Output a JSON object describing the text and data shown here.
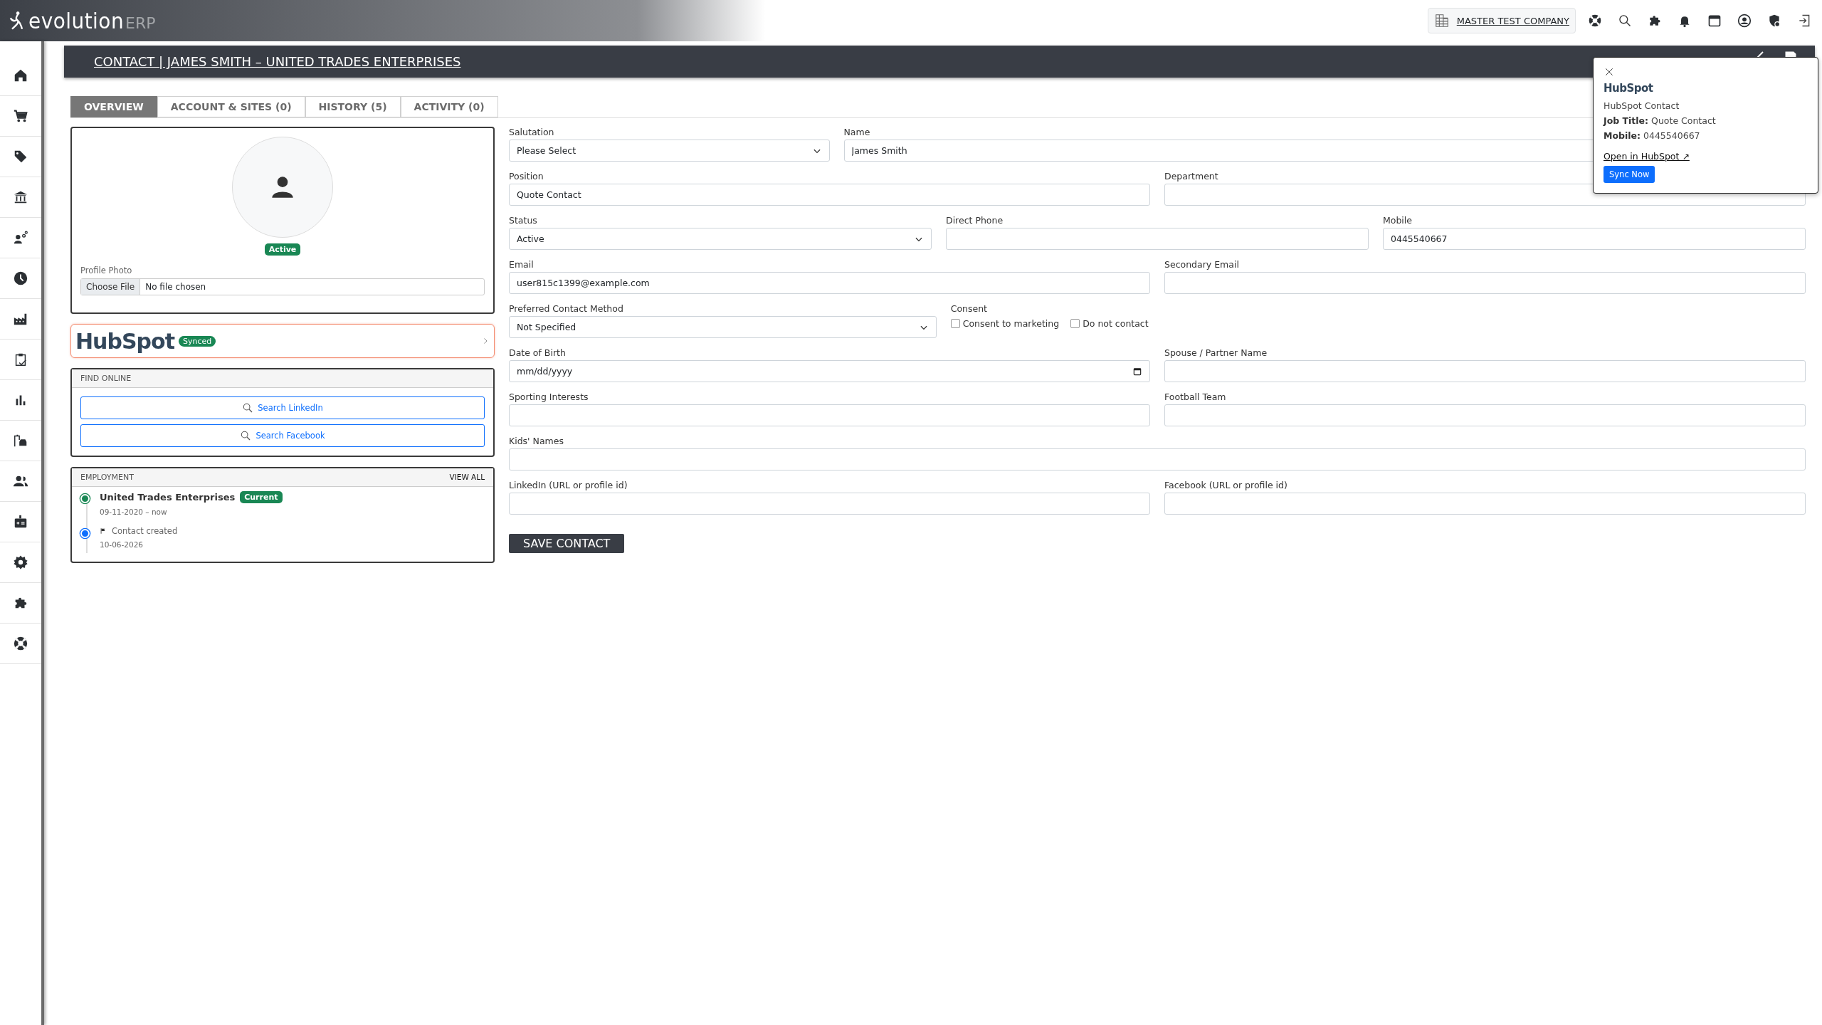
{
  "topbar": {
    "logo": {
      "word": "evolution",
      "suffix": "ERP"
    },
    "company": "MASTER TEST COMPANY"
  },
  "title": "CONTACT | JAMES SMITH – UNITED TRADES ENTERPRISES",
  "tabs": [
    {
      "label": "OVERVIEW",
      "selected": true
    },
    {
      "label": "ACCOUNT & SITES (0)",
      "selected": false
    },
    {
      "label": "HISTORY (5)",
      "selected": false
    },
    {
      "label": "ACTIVITY (0)",
      "selected": false
    }
  ],
  "profile": {
    "status": "Active",
    "photo_label": "Profile Photo",
    "file_button": "Choose File",
    "file_status": "No file chosen"
  },
  "hubspot_card": {
    "logo": "HubSpot",
    "badge": "Synced"
  },
  "find_online": {
    "heading": "FIND ONLINE",
    "buttons": [
      "Search LinkedIn",
      "Search Facebook"
    ]
  },
  "employment": {
    "heading": "EMPLOYMENT",
    "view_all": "VIEW ALL",
    "items": [
      {
        "kind": "job",
        "title": "United Trades Enterprises",
        "badge": "Current",
        "dates": "09-11-2020 – now",
        "color": "#198754"
      },
      {
        "kind": "event",
        "text": "Contact created",
        "date": "10-06-2026",
        "color": "#0d6efd"
      }
    ]
  },
  "form": {
    "rows": [
      [
        {
          "kind": "select",
          "label": "Salutation",
          "value": "Please Select"
        },
        {
          "kind": "text",
          "label": "Name",
          "value": "James Smith"
        }
      ],
      [
        {
          "kind": "text",
          "label": "Position",
          "value": "Quote Contact"
        },
        {
          "kind": "text",
          "label": "Department"
        }
      ],
      [
        {
          "kind": "select",
          "label": "Status",
          "value": "Active"
        },
        {
          "kind": "text",
          "label": "Direct Phone"
        },
        {
          "kind": "text",
          "label": "Mobile",
          "value": "0445540667"
        }
      ],
      [
        {
          "kind": "text",
          "label": "Email",
          "value": "user815c1399@example.com"
        },
        {
          "kind": "text",
          "label": "Secondary Email"
        }
      ],
      [
        {
          "kind": "select",
          "label": "Preferred Contact Method",
          "value": "Not Specified"
        },
        {
          "kind": "checks",
          "label": "Consent",
          "options": [
            {
              "label": "Consent to marketing",
              "checked": false
            },
            {
              "label": "Do not contact",
              "checked": false
            }
          ]
        }
      ],
      [
        {
          "kind": "date",
          "label": "Date of Birth",
          "placeholder": "mm/dd/yyyy"
        },
        {
          "kind": "text",
          "label": "Spouse / Partner Name"
        }
      ],
      [
        {
          "kind": "text",
          "label": "Sporting Interests"
        },
        {
          "kind": "text",
          "label": "Football Team"
        }
      ],
      [
        {
          "kind": "text",
          "label": "Kids' Names"
        }
      ],
      [
        {
          "kind": "text",
          "label": "LinkedIn (URL or profile id)"
        },
        {
          "kind": "text",
          "label": "Facebook (URL or profile id)"
        }
      ]
    ],
    "save": "SAVE CONTACT"
  },
  "popup": {
    "logo": "HubSpot",
    "heading": "HubSpot Contact",
    "details": [
      {
        "label": "Job Title:",
        "value": "Quote Contact"
      },
      {
        "label": "Mobile:",
        "value": "0445540667"
      }
    ],
    "link": "Open in HubSpot ↗",
    "button": "Sync Now"
  }
}
